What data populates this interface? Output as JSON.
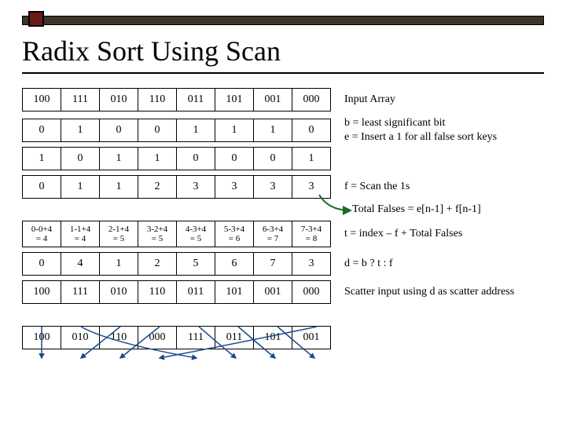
{
  "title": "Radix Sort Using Scan",
  "rows": [
    {
      "cells": [
        "100",
        "111",
        "010",
        "110",
        "011",
        "101",
        "001",
        "000"
      ],
      "note": "Input Array"
    },
    {
      "cells": [
        "0",
        "1",
        "0",
        "0",
        "1",
        "1",
        "1",
        "0"
      ],
      "note": "b = least significant bit"
    },
    {
      "cells": [
        "1",
        "0",
        "1",
        "1",
        "0",
        "0",
        "0",
        "1"
      ],
      "note": "e = Insert a 1 for all false sort keys"
    },
    {
      "cells": [
        "0",
        "1",
        "1",
        "2",
        "3",
        "3",
        "3",
        "3"
      ],
      "note": "f = Scan the 1s"
    }
  ],
  "total_note": "Total Falses = e[n-1] + f[n-1]",
  "t_row_formulas": [
    "0-0+4",
    "1-1+4",
    "2-1+4",
    "3-2+4",
    "4-3+4",
    "5-3+4",
    "6-3+4",
    "7-3+4"
  ],
  "t_row_values": [
    "= 4",
    "= 4",
    "= 5",
    "= 5",
    "= 5",
    "= 6",
    "= 7",
    "= 8"
  ],
  "t_note": "t = index – f + Total Falses",
  "d_row": [
    "0",
    "4",
    "1",
    "2",
    "5",
    "6",
    "7",
    "3"
  ],
  "d_note": "d = b ? t : f",
  "scatter_in": [
    "100",
    "111",
    "010",
    "110",
    "011",
    "101",
    "001",
    "000"
  ],
  "scatter_note": "Scatter input using d as scatter address",
  "scatter_out": [
    "100",
    "010",
    "110",
    "000",
    "111",
    "011",
    "101",
    "001"
  ]
}
